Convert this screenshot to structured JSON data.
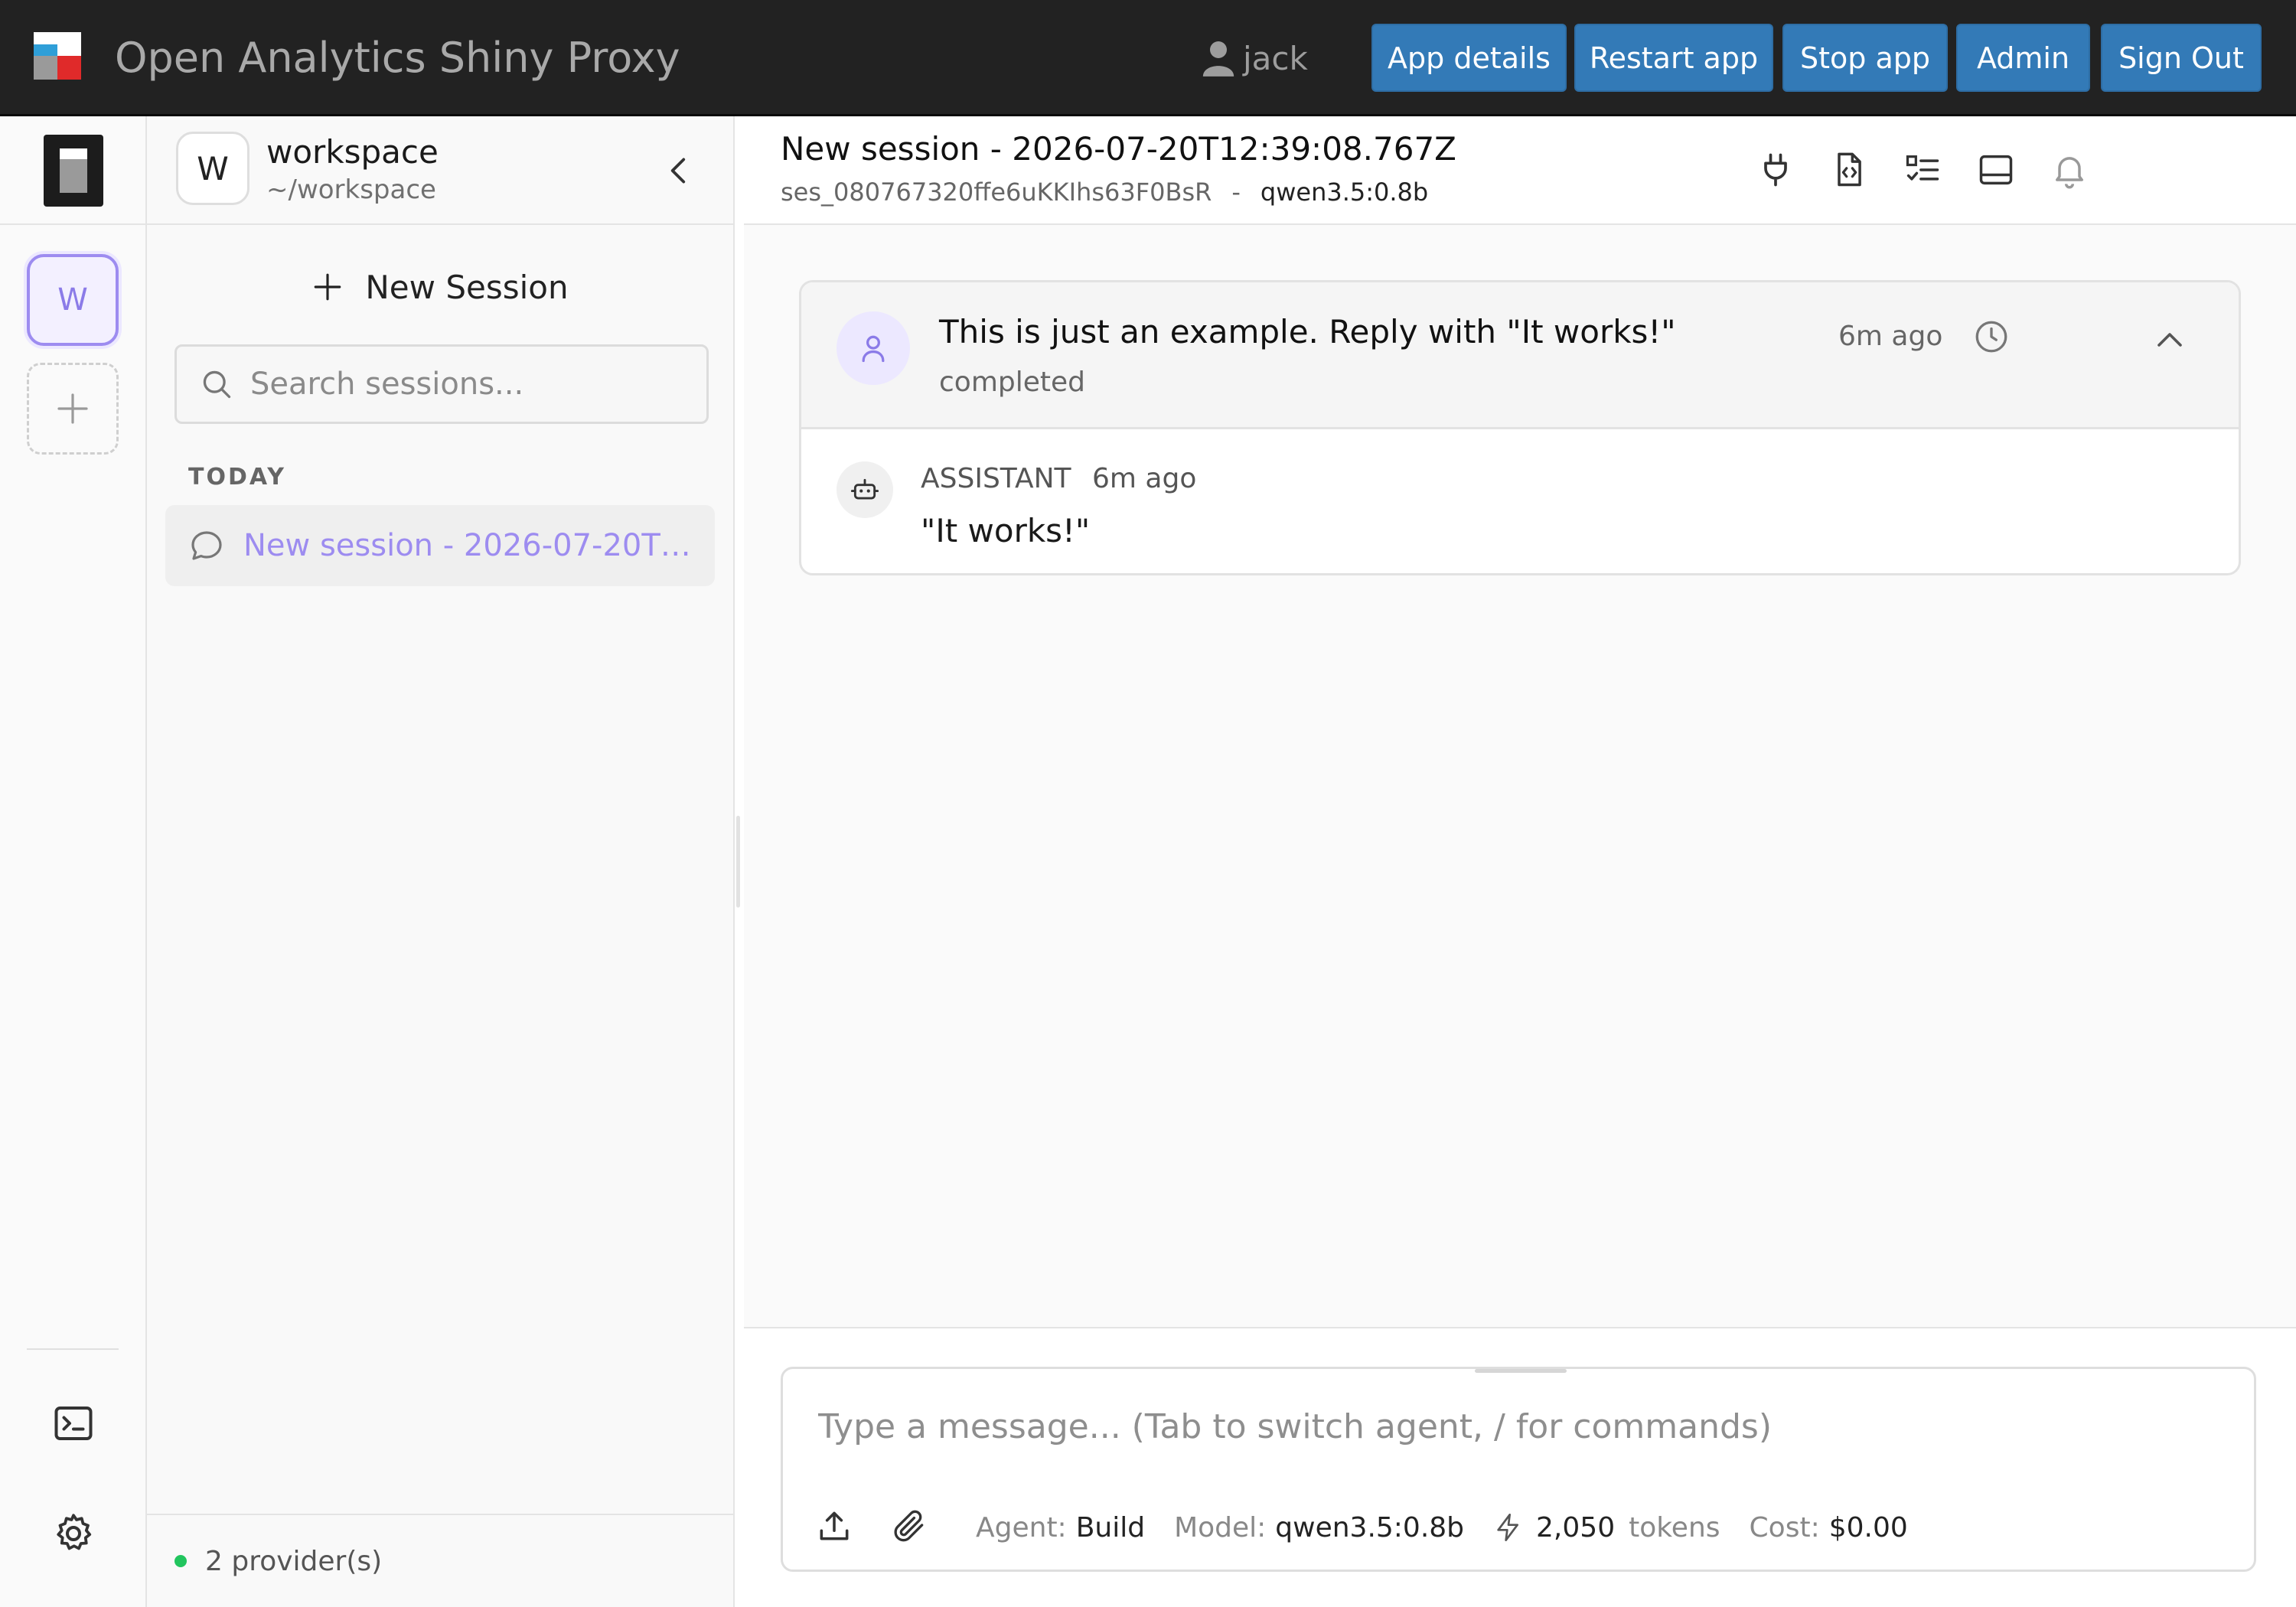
{
  "navbar": {
    "title": "Open Analytics Shiny Proxy",
    "user": "jack",
    "buttons": [
      "App details",
      "Restart app",
      "Stop app",
      "Admin",
      "Sign Out"
    ],
    "logo_colors": [
      "#ffffff",
      "#2f9fd8",
      "#9a9a9a",
      "#e02a2a"
    ]
  },
  "rail": {
    "workspace_letter": "W",
    "icons": [
      "app-logo-icon",
      "plus-icon",
      "terminal-icon",
      "gear-icon"
    ]
  },
  "sidebar": {
    "workspace_letter": "W",
    "workspace_name": "workspace",
    "workspace_path": "~/workspace",
    "new_session_label": "New Session",
    "search_placeholder": "Search sessions...",
    "group_label": "TODAY",
    "sessions": [
      {
        "title": "New session - 2026-07-20T1..."
      }
    ],
    "footer_status": "2 provider(s)",
    "status_color": "#22c55e"
  },
  "main": {
    "session_title": "New session - 2026-07-20T12:39:08.767Z",
    "session_id": "ses_080767320ffe6uKKIhs63F0BsR",
    "meta_separator": "-",
    "model": "qwen3.5:0.8b",
    "header_icons": [
      "plug-icon",
      "file-code-icon",
      "checklist-icon",
      "panel-icon",
      "bell-icon"
    ]
  },
  "thread": {
    "user_message": "This is just an example. Reply with \"It works!\"",
    "user_status": "completed",
    "user_time": "6m ago",
    "assistant_role": "ASSISTANT",
    "assistant_time": "6m ago",
    "assistant_text": "\"It works!\"",
    "accent_color": "#9d8cf0"
  },
  "composer": {
    "placeholder": "Type a message... (Tab to switch agent, / for commands)",
    "agent_label": "Agent:",
    "agent_value": "Build",
    "model_label": "Model:",
    "model_value": "qwen3.5:0.8b",
    "tokens_value": "2,050",
    "tokens_label": "tokens",
    "cost_label": "Cost:",
    "cost_value": "$0.00"
  }
}
